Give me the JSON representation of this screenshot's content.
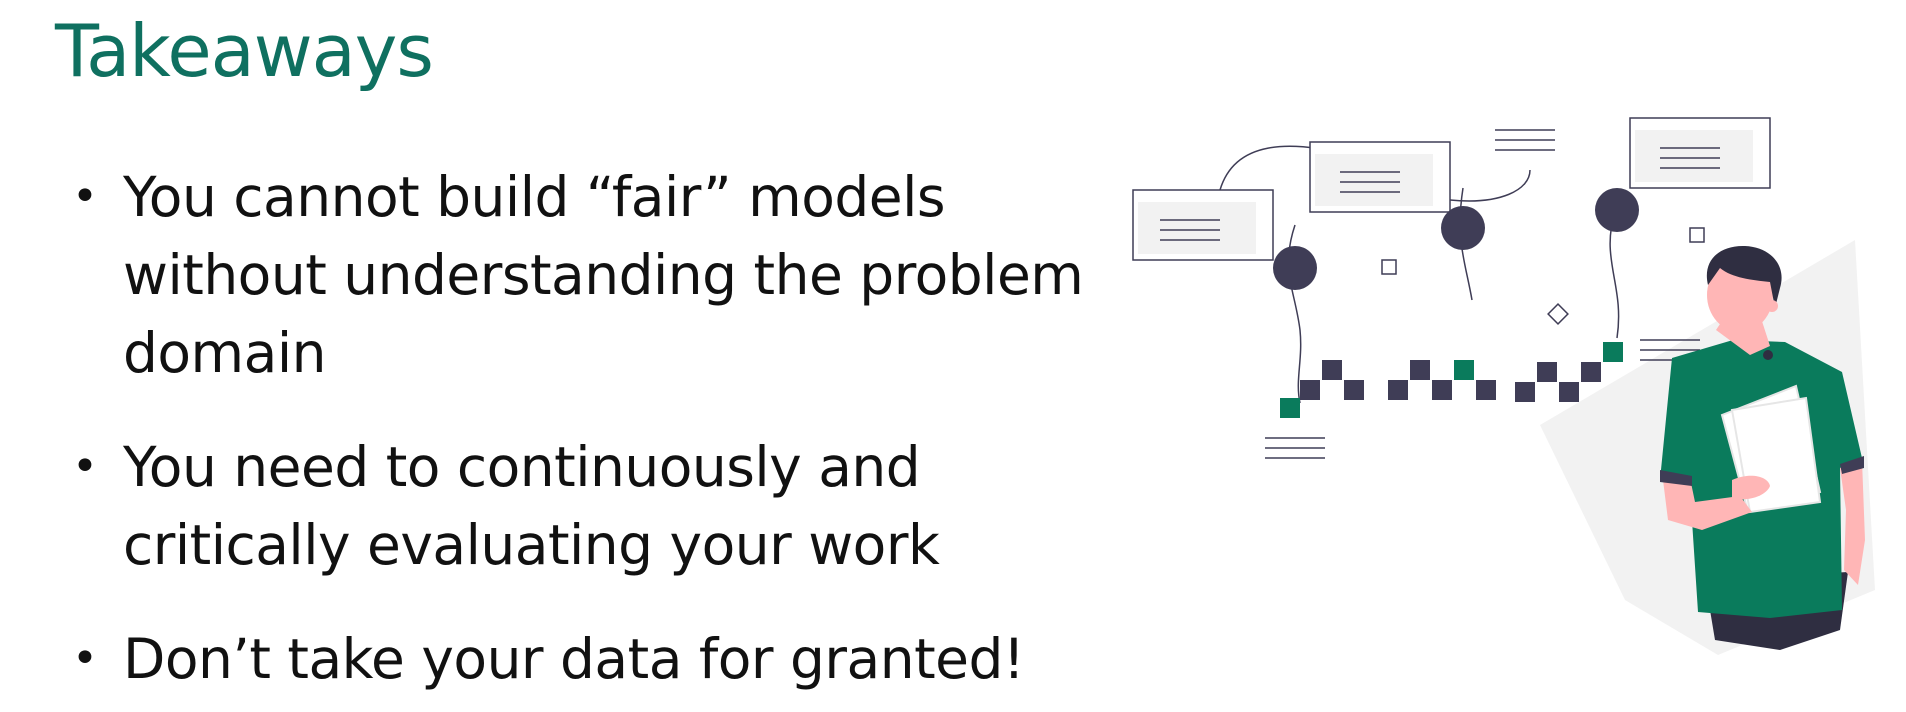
{
  "slide": {
    "title": "Takeaways",
    "bullets": [
      "You cannot build “fair” models without understanding the problem domain",
      "You need to continuously and critically evaluating your work",
      "Don’t take your data for granted!"
    ]
  },
  "colors": {
    "title": "#0f7060",
    "accent": "#0a7b5c",
    "dark": "#3f3d56",
    "skin": "#ffb6b6"
  },
  "illustration": {
    "icon": "person-with-flowchart-illustration"
  }
}
